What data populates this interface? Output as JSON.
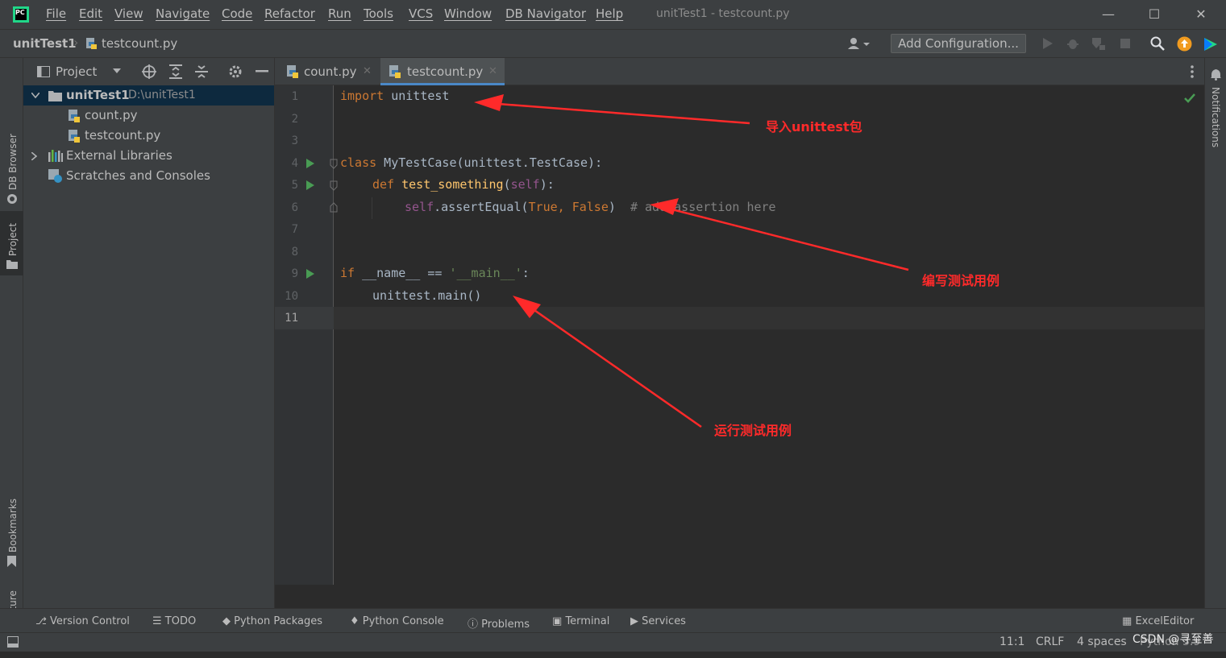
{
  "menu": [
    "File",
    "Edit",
    "View",
    "Navigate",
    "Code",
    "Refactor",
    "Run",
    "Tools",
    "VCS",
    "Window",
    "DB Navigator",
    "Help"
  ],
  "window_title": "unitTest1 - testcount.py",
  "breadcrumb": {
    "project": "unitTest1",
    "file": "testcount.py"
  },
  "toolbar": {
    "add_config": "Add Configuration..."
  },
  "left_stripe": {
    "db_browser": "DB Browser",
    "project": "Project",
    "bookmarks": "Bookmarks",
    "structure": "Structure"
  },
  "right_stripe": {
    "notifications": "Notifications"
  },
  "project_panel": {
    "title": "Project",
    "root_name": "unitTest1",
    "root_path": "D:\\unitTest1",
    "files": [
      "count.py",
      "testcount.py"
    ],
    "external": "External Libraries",
    "scratches": "Scratches and Consoles"
  },
  "editor_tabs": [
    "count.py",
    "testcount.py"
  ],
  "line_numbers": [
    "1",
    "2",
    "3",
    "4",
    "5",
    "6",
    "7",
    "8",
    "9",
    "10",
    "11"
  ],
  "code": {
    "l1_kw": "import",
    "l1_rest": " unittest",
    "l4_kw": "class",
    "l4_rest": " MyTestCase(unittest.TestCase):",
    "l5_kw": "def",
    "l5_fn": "test_something",
    "l5_p1": "(",
    "l5_self": "self",
    "l5_p2": "):",
    "l6_self": "self",
    "l6_mid": ".assertEqual(",
    "l6_true": "True",
    "l6_comma": ", ",
    "l6_false": "False",
    "l6_close": ")",
    "l6_cmt": "  # add assertion here",
    "l9_kw": "if",
    "l9_mid": " __name__ == ",
    "l9_str": "'__main__'",
    "l9_end": ":",
    "l10": "unittest.main()"
  },
  "annotations": {
    "import": "导入unittest包",
    "write": "编写测试用例",
    "run": "运行测试用例"
  },
  "bottom_tools": [
    "Version Control",
    "TODO",
    "Python Packages",
    "Python Console",
    "Problems",
    "Terminal",
    "Services",
    "ExcelEditor"
  ],
  "status": {
    "position": "11:1",
    "line_sep": "CRLF",
    "indent": "4 spaces",
    "interpreter": "Python 3.9",
    "watermark": "CSDN @寻至善"
  },
  "colors": {
    "accent_tab": "#4a88c7",
    "run_green": "#499c54",
    "annotation_red": "#ff2a2a"
  }
}
